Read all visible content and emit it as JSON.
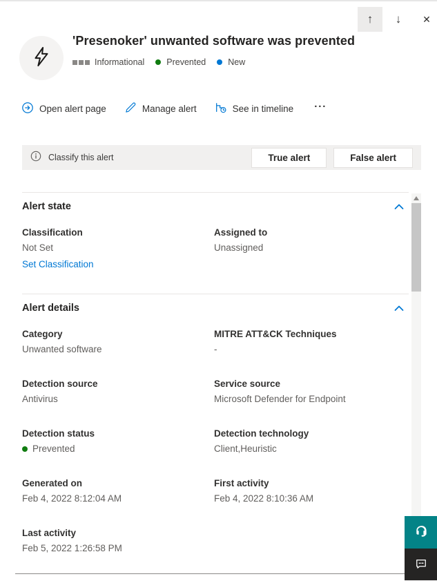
{
  "window_controls": {
    "scroll_up_icon": "↑",
    "scroll_down_icon": "↓",
    "close_icon": "✕"
  },
  "header": {
    "title": "'Presenoker' unwanted software was prevented",
    "severity": "Informational",
    "detection_status": "Prevented",
    "alert_state": "New"
  },
  "toolbar": {
    "open_alert_page": "Open alert page",
    "manage_alert": "Manage alert",
    "see_in_timeline": "See in timeline",
    "more_icon": "···"
  },
  "classify_bar": {
    "label": "Classify this alert",
    "true_button": "True alert",
    "false_button": "False alert"
  },
  "alert_state_section": {
    "title": "Alert state",
    "classification_label": "Classification",
    "classification_value": "Not Set",
    "set_classification_link": "Set Classification",
    "assigned_to_label": "Assigned to",
    "assigned_to_value": "Unassigned"
  },
  "alert_details_section": {
    "title": "Alert details",
    "fields": [
      {
        "label": "Category",
        "value": "Unwanted software"
      },
      {
        "label": "MITRE ATT&CK Techniques",
        "value": "-"
      },
      {
        "label": "Detection source",
        "value": "Antivirus"
      },
      {
        "label": "Service source",
        "value": "Microsoft Defender for Endpoint"
      },
      {
        "label": "Detection status",
        "value": "Prevented"
      },
      {
        "label": "Detection technology",
        "value": "Client,Heuristic"
      },
      {
        "label": "Generated on",
        "value": "Feb 4, 2022 8:12:04 AM"
      },
      {
        "label": "First activity",
        "value": "Feb 4, 2022 8:10:36 AM"
      },
      {
        "label": "Last activity",
        "value": "Feb 5, 2022 1:26:58 PM"
      }
    ]
  },
  "colors": {
    "accent_blue": "#0078d4",
    "prevented_green": "#107c10",
    "severity_gray": "#8a8886",
    "support_teal": "#038387",
    "feedback_dark": "#252423"
  }
}
